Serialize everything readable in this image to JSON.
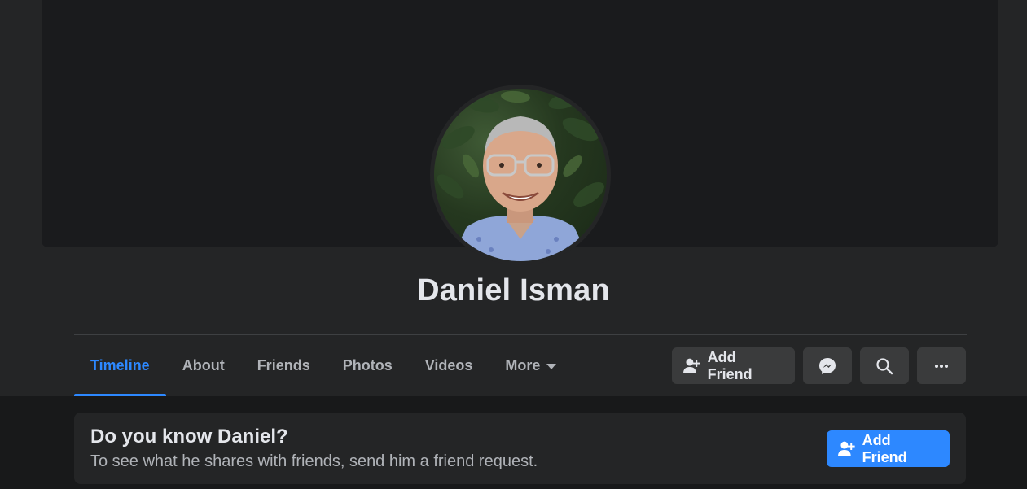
{
  "profile": {
    "name": "Daniel Isman"
  },
  "tabs": [
    {
      "label": "Timeline",
      "active": true
    },
    {
      "label": "About"
    },
    {
      "label": "Friends"
    },
    {
      "label": "Photos"
    },
    {
      "label": "Videos"
    },
    {
      "label": "More"
    }
  ],
  "actions": {
    "add_friend_label": "Add Friend",
    "messenger_icon": "messenger-icon",
    "search_icon": "search-icon",
    "more_icon": "ellipsis-icon"
  },
  "know_card": {
    "title": "Do you know Daniel?",
    "subtitle": "To see what he shares with friends, send him a friend request.",
    "button_label": "Add Friend"
  },
  "colors": {
    "accent": "#2d88ff",
    "background": "#18191a",
    "surface": "#242526",
    "button": "#3a3b3c"
  }
}
